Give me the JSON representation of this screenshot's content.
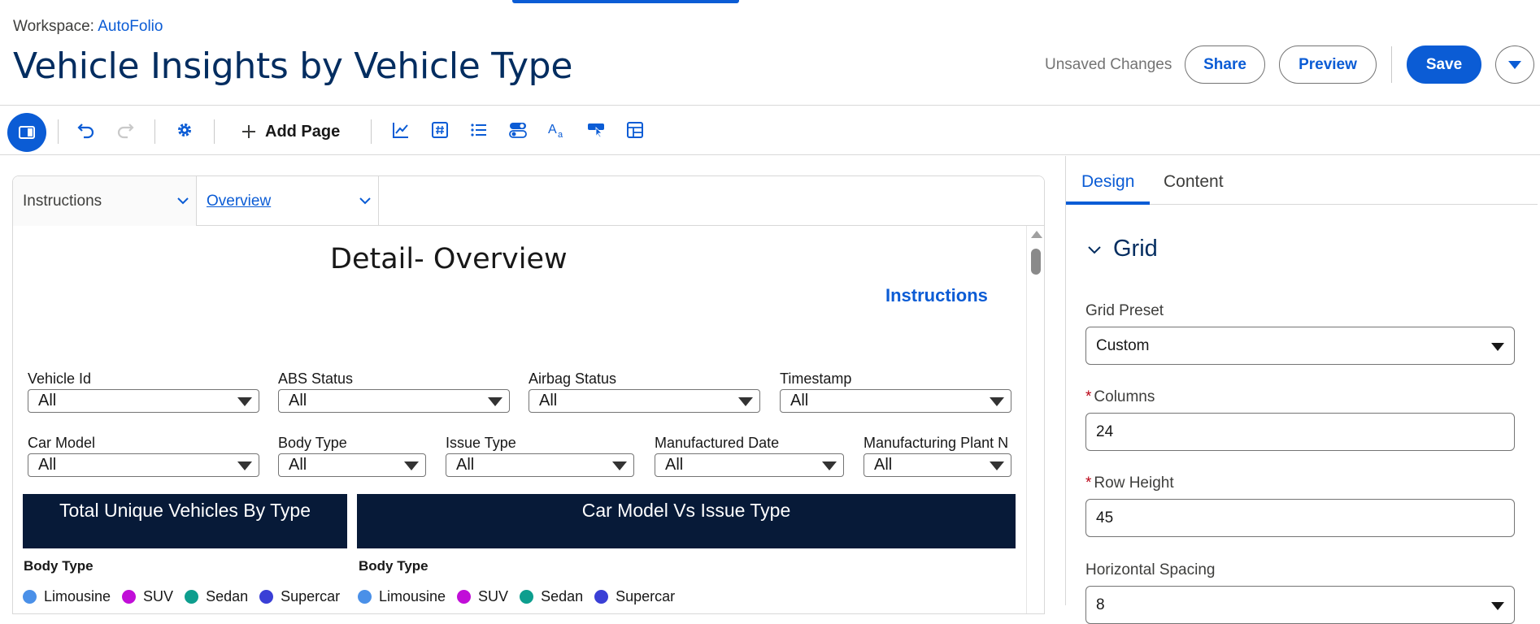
{
  "header": {
    "workspace_label": "Workspace:",
    "workspace_name": "AutoFolio",
    "title": "Vehicle Insights by Vehicle Type",
    "unsaved": "Unsaved Changes",
    "share": "Share",
    "preview": "Preview",
    "save": "Save"
  },
  "toolbar": {
    "add_page": "Add Page",
    "icons": [
      "panel-toggle-icon",
      "undo-icon",
      "redo-icon",
      "settings-gear-icon",
      "chart-icon",
      "number-icon",
      "list-icon",
      "toggle-icon",
      "text-icon",
      "link-button-icon",
      "table-icon"
    ]
  },
  "canvas": {
    "tabs": [
      "Instructions",
      "Overview"
    ],
    "detail_title": "Detail- Overview",
    "instructions_link": "Instructions",
    "filters_row1": [
      {
        "label": "Vehicle Id",
        "value": "All"
      },
      {
        "label": "ABS Status",
        "value": "All"
      },
      {
        "label": "Airbag Status",
        "value": "All"
      },
      {
        "label": "Timestamp",
        "value": "All"
      }
    ],
    "filters_row2": [
      {
        "label": "Car Model",
        "value": "All"
      },
      {
        "label": "Body Type",
        "value": "All"
      },
      {
        "label": "Issue Type",
        "value": "All"
      },
      {
        "label": "Manufactured Date",
        "value": "All"
      },
      {
        "label": "Manufacturing Plant N",
        "value": "All"
      }
    ],
    "banners": [
      "Total Unique Vehicles By Type",
      "Car Model Vs Issue Type"
    ],
    "legend_title": "Body Type",
    "legend": [
      {
        "label": "Limousine",
        "color": "#4a90e8"
      },
      {
        "label": "SUV",
        "color": "#c10ed8"
      },
      {
        "label": "Sedan",
        "color": "#0d9e8e"
      },
      {
        "label": "Supercar",
        "color": "#3a3fd6"
      }
    ]
  },
  "panel": {
    "tabs": [
      "Design",
      "Content"
    ],
    "section": "Grid",
    "grid_preset_label": "Grid Preset",
    "grid_preset_value": "Custom",
    "columns_label": "Columns",
    "columns_value": "24",
    "row_height_label": "Row Height",
    "row_height_value": "45",
    "horizontal_spacing_label": "Horizontal Spacing",
    "horizontal_spacing_value": "8"
  },
  "colors": {
    "accent": "#0b5cd5",
    "title": "#032d60",
    "banner": "#071a38"
  }
}
